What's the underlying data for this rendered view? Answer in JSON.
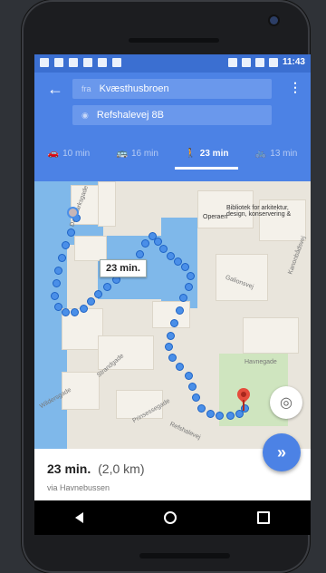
{
  "status_bar": {
    "time": "11:43"
  },
  "search": {
    "from_prefix": "fra",
    "from": "Kvæsthusbroen",
    "to": "Refshalevej 8B"
  },
  "modes": [
    {
      "name": "car",
      "label": "10 min",
      "icon": "car-icon"
    },
    {
      "name": "transit",
      "label": "16 min",
      "icon": "bus-icon"
    },
    {
      "name": "walk",
      "label": "23 min",
      "icon": "walk-icon",
      "active": true
    },
    {
      "name": "bike",
      "label": "13 min",
      "icon": "bike-icon"
    }
  ],
  "map": {
    "route_bubble": "23 min.",
    "labels": {
      "operaen": "Operaen",
      "library": "Bibliotek for arkitektur, design, konservering &",
      "galionsvej": "Galionsvej",
      "kanonbadsvej": "Kanonbådsvej",
      "strandgade": "Strandgade",
      "wildersgade": "Wildersgade",
      "prinsessegade": "Prinsessegade",
      "refshalevej": "Refshalevej",
      "havnegade": "Havnegade",
      "danmarksgade": "Danmarksgade"
    }
  },
  "summary": {
    "duration": "23 min.",
    "distance": "(2,0 km)",
    "via": "via Havnebussen"
  }
}
